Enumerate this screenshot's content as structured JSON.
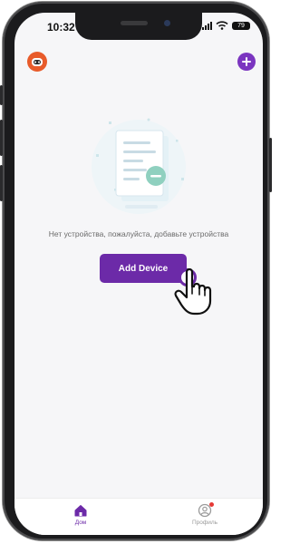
{
  "status_bar": {
    "time": "10:32",
    "battery": "79"
  },
  "header": {
    "avatar_icon": "robot-avatar-icon",
    "add_icon": "plus-icon"
  },
  "empty_state": {
    "illustration_icon": "empty-document-icon",
    "message": "Нет устройства, пожалуйста, добавьте устройства"
  },
  "actions": {
    "add_device_label": "Add Device"
  },
  "tabbar": {
    "home_label": "Дом",
    "profile_label": "Профиль"
  },
  "colors": {
    "accent": "#6c2aa8",
    "avatar": "#e85b2a",
    "notification": "#e53935"
  }
}
